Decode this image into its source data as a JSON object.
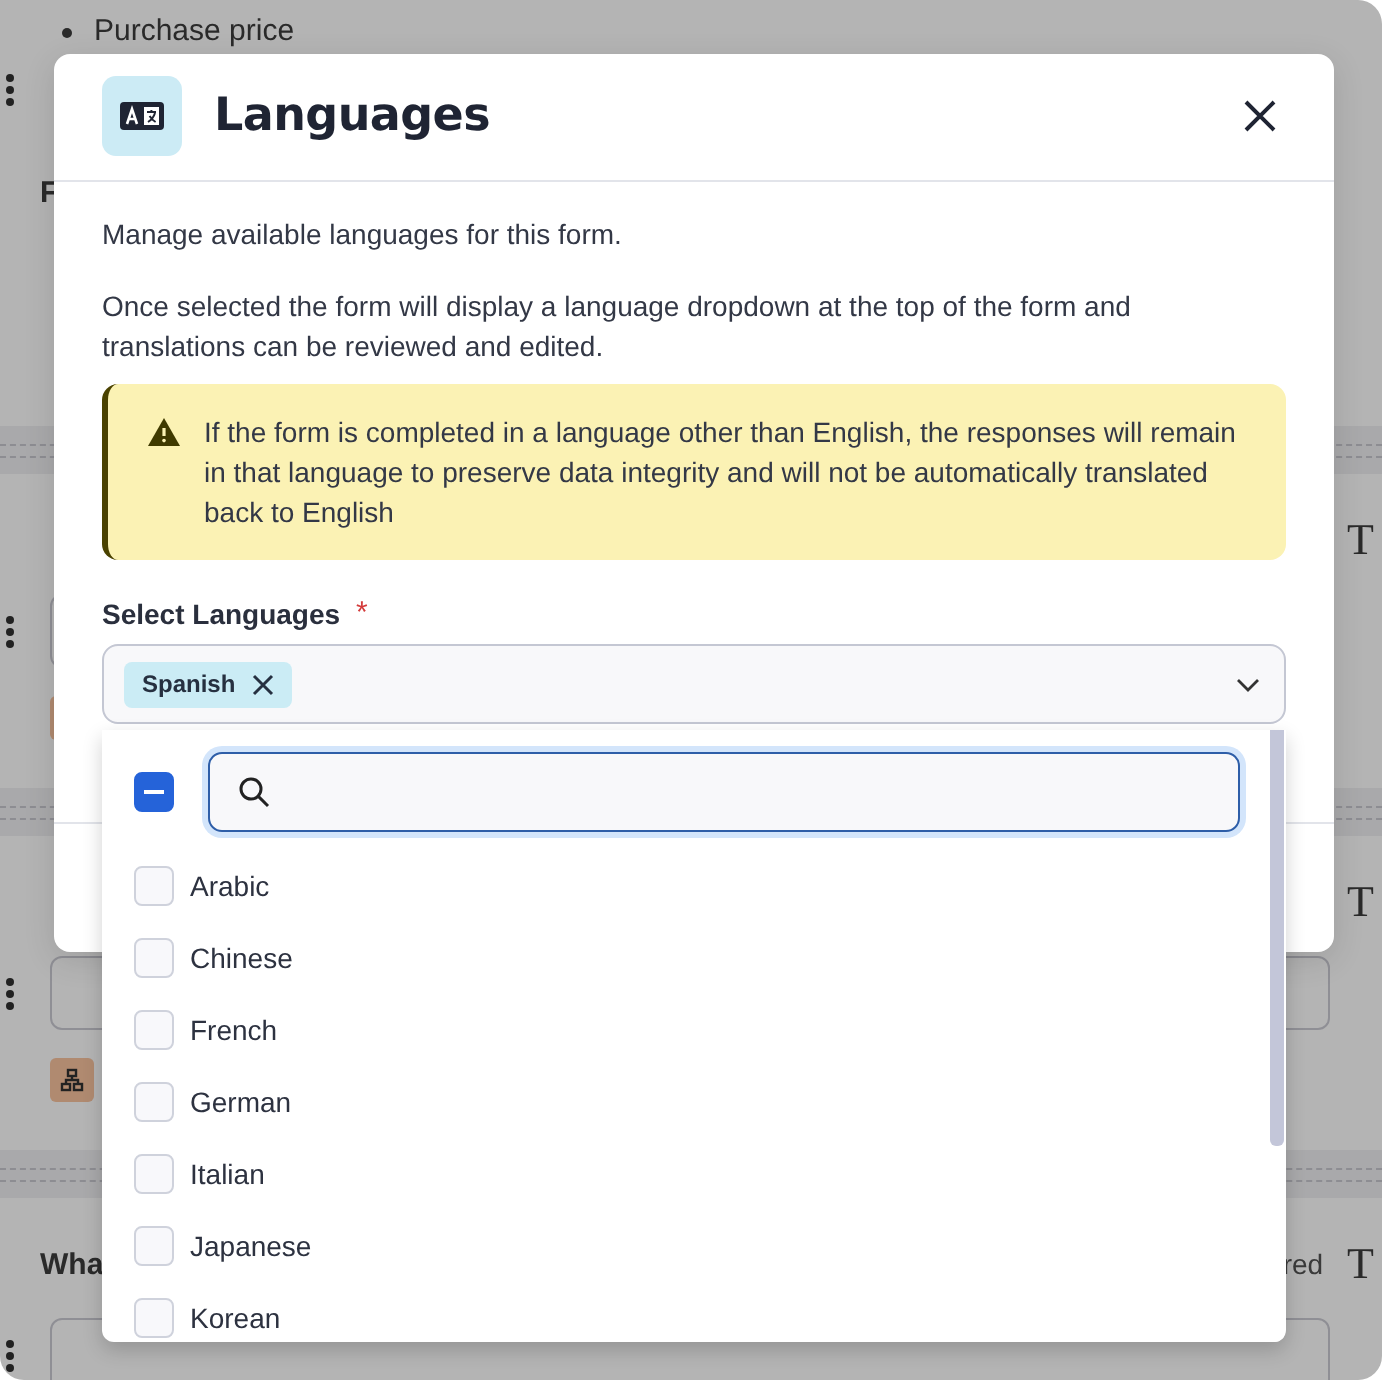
{
  "background": {
    "bullet_items": [
      "Purchase price"
    ],
    "intro_label": "F",
    "questions": [
      {
        "glyph": "T",
        "tag_icon": true
      },
      {
        "glyph": "T",
        "tag_icon": true
      },
      {
        "label": "Wha",
        "status": "red",
        "glyph": "T",
        "tag_icon": false
      }
    ]
  },
  "dialog": {
    "title": "Languages",
    "intro": "Manage available languages for this form.",
    "description": "Once selected the form will display a language dropdown at the top of the form and translations can be reviewed and edited.",
    "alert": "If the form is completed in a language other than English, the responses will remain in that language to preserve data integrity and will not be automatically translated back to English",
    "field": {
      "label": "Select Languages",
      "required_mark": "*",
      "chips": [
        {
          "label": "Spanish"
        }
      ]
    },
    "dropdown": {
      "select_all": {
        "indeterminate": true
      },
      "options": [
        {
          "label": "Arabic",
          "checked": false
        },
        {
          "label": "Chinese",
          "checked": false
        },
        {
          "label": "French",
          "checked": false
        },
        {
          "label": "German",
          "checked": false
        },
        {
          "label": "Italian",
          "checked": false
        },
        {
          "label": "Japanese",
          "checked": false
        },
        {
          "label": "Korean",
          "checked": false
        }
      ]
    }
  }
}
